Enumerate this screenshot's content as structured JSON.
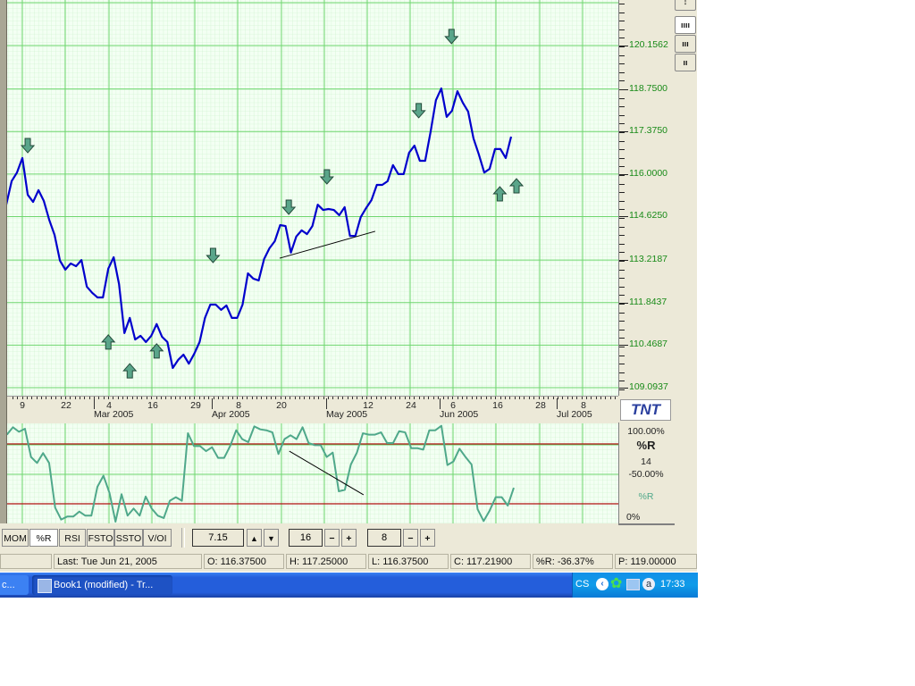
{
  "colors": {
    "grid_major": "#6ed66e",
    "grid_minor": "#c5efc5",
    "chart_bg": "#f3fff3",
    "price_line": "#0000cc",
    "pr_line": "#4fa88a",
    "level_line": "#b01010",
    "arrow": "#5aa58a"
  },
  "chart_data": [
    {
      "type": "line",
      "title": "Price",
      "series": [
        {
          "name": "Close",
          "values": [
            115.01,
            115.77,
            116.05,
            116.52,
            115.33,
            115.1,
            115.48,
            115.13,
            114.52,
            114.03,
            113.2,
            112.91,
            113.11,
            113.02,
            113.22,
            112.36,
            112.16,
            112.01,
            112.01,
            112.94,
            113.31,
            112.44,
            110.86,
            111.35,
            110.65,
            110.77,
            110.57,
            110.77,
            111.15,
            110.74,
            110.57,
            109.73,
            109.99,
            110.16,
            109.87,
            110.19,
            110.57,
            111.35,
            111.78,
            111.78,
            111.61,
            111.75,
            111.35,
            111.35,
            111.78,
            112.79,
            112.62,
            112.56,
            113.25,
            113.6,
            113.83,
            114.35,
            114.32,
            113.46,
            113.98,
            114.18,
            114.06,
            114.32,
            115.01,
            114.84,
            114.87,
            114.84,
            114.67,
            114.93,
            114.0,
            114.0,
            114.61,
            114.9,
            115.16,
            115.65,
            115.65,
            115.77,
            116.29,
            116.0,
            116.0,
            116.69,
            116.92,
            116.43,
            116.43,
            117.36,
            118.39,
            118.77,
            117.85,
            118.05,
            118.68,
            118.31,
            118.02,
            117.15,
            116.63,
            116.05,
            116.17,
            116.81,
            116.81,
            116.52,
            117.21
          ]
        }
      ],
      "ylim": [
        109.0937,
        120.1562
      ],
      "y_ticks": [
        "120.1562",
        "118.7500",
        "117.3750",
        "116.0000",
        "114.6250",
        "113.2187",
        "111.8437",
        "110.4687",
        "109.0937"
      ],
      "y_tick_values": [
        120.1562,
        118.75,
        117.375,
        116.0,
        114.625,
        113.2187,
        111.8437,
        110.4687,
        109.0937
      ],
      "x_day_ticks": [
        "9",
        "22",
        "4",
        "16",
        "29",
        "8",
        "20",
        "12",
        "24",
        "6",
        "16",
        "28",
        "8"
      ],
      "x_month_ticks": [
        "Mar 2005",
        "Apr 2005",
        "May 2005",
        "Jun 2005",
        "Jul 2005"
      ],
      "signals": [
        {
          "type": "sell",
          "bar": 4,
          "price": 116.92
        },
        {
          "type": "buy",
          "bar": 19,
          "price": 110.57
        },
        {
          "type": "buy",
          "bar": 23,
          "price": 109.64
        },
        {
          "type": "buy",
          "bar": 28,
          "price": 110.28
        },
        {
          "type": "sell",
          "bar": 38.5,
          "price": 113.37
        },
        {
          "type": "sell",
          "bar": 52.6,
          "price": 114.93
        },
        {
          "type": "sell",
          "bar": 59.7,
          "price": 115.91
        },
        {
          "type": "sell",
          "bar": 76.8,
          "price": 118.05
        },
        {
          "type": "sell",
          "bar": 82.9,
          "price": 120.45
        },
        {
          "type": "buy",
          "bar": 91.9,
          "price": 115.36
        },
        {
          "type": "buy",
          "bar": 95,
          "price": 115.62
        }
      ],
      "trendline": {
        "from": [
          50.9,
          113.28
        ],
        "to": [
          68.7,
          114.15
        ]
      }
    },
    {
      "type": "line",
      "title": "%R",
      "period": "14",
      "series": [
        {
          "name": "%R",
          "values": [
            89.3,
            96.7,
            92.2,
            95.2,
            66.9,
            60.9,
            70.8,
            60.9,
            16.1,
            4.2,
            7.2,
            7.2,
            12.2,
            8.1,
            8.1,
            37.0,
            48.1,
            31.0,
            2.1,
            29.6,
            8.1,
            15.2,
            8.1,
            27.2,
            15.2,
            8.1,
            5.7,
            23.0,
            26.6,
            23.0,
            90.7,
            77.9,
            77.9,
            72.8,
            76.7,
            66.0,
            66.0,
            77.9,
            93.7,
            84.8,
            81.8,
            97.6,
            94.6,
            93.7,
            91.6,
            69.9,
            84.8,
            88.7,
            84.8,
            96.7,
            80.9,
            78.8,
            78.8,
            66.9,
            71.3,
            32.5,
            34.0,
            59.4,
            71.3,
            90.7,
            89.3,
            89.3,
            91.6,
            80.9,
            80.9,
            92.8,
            91.6,
            75.8,
            75.8,
            74.3,
            93.7,
            93.7,
            98.2,
            58.8,
            62.4,
            75.2,
            66.9,
            59.4,
            14.6,
            2.7,
            13.2,
            26.6,
            26.6,
            18.2,
            36.1
          ]
        }
      ],
      "levels": [
        80,
        20
      ],
      "ylim": [
        0,
        100
      ],
      "trendline": {
        "from": [
          46.8,
          72.8
        ],
        "to": [
          59.1,
          29.0
        ]
      }
    }
  ],
  "indicator_panel": {
    "top_label": "100.00%",
    "name": "%R",
    "period": "14",
    "mid_label": "-50.00%",
    "legend": "%R",
    "bottom_label": "0%"
  },
  "logo": "TNT",
  "side_buttons": [
    "↕",
    "ıııı",
    "ııı",
    "ıı"
  ],
  "toolbar": {
    "tabs": [
      "MOM",
      "%R",
      "RSI",
      "FSTO",
      "SSTO",
      "V/OI"
    ],
    "active_tab": "%R",
    "field1": "7.15",
    "field2": "16",
    "field3": "8",
    "up": "▲",
    "down": "▼",
    "minus": "−",
    "plus": "+"
  },
  "status": {
    "last": "Last: Tue Jun 21, 2005",
    "open": "O: 116.37500",
    "high": "H: 117.25000",
    "low": "L: 116.37500",
    "close": "C: 117.21900",
    "pr": "%R: -36.37%",
    "p": "P: 119.00000"
  },
  "taskbar": {
    "btn1": "c...",
    "btn2": "Book1 (modified) - Tr...",
    "lang": "CS",
    "clock": "17:33"
  }
}
